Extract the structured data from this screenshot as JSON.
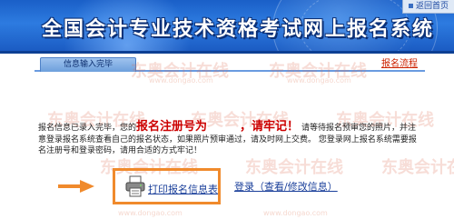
{
  "header": {
    "title": "全国会计专业技术资格考试网上报名系统",
    "home_link": "返回首页"
  },
  "tabs": {
    "active": "信息输入完毕",
    "process_link": "报名流程"
  },
  "watermark": {
    "brand": "东奥会计在线",
    "url": "www.dongao.com"
  },
  "notice": {
    "p1": "报名信息已录入完毕，您的",
    "emphasis1": "报名注册号为",
    "emphasis2": "，请牢记！",
    "p2": "请等待报名预审您的照片，并注意登录报名系统查看自己的报名状态，如果照片预审通过，请及时网上交费。 您登录网上报名系统需要报名注册号和登录密码，请用合适的方式牢记！"
  },
  "actions": {
    "print_label": "打印报名信息表",
    "login_label": "登录（查看/修改信息）"
  },
  "colors": {
    "header_blue": "#1b5cc3",
    "highlight_orange": "#f08a2c",
    "emphasis_red": "#cc0000",
    "link_blue": "#1a3f9a"
  }
}
